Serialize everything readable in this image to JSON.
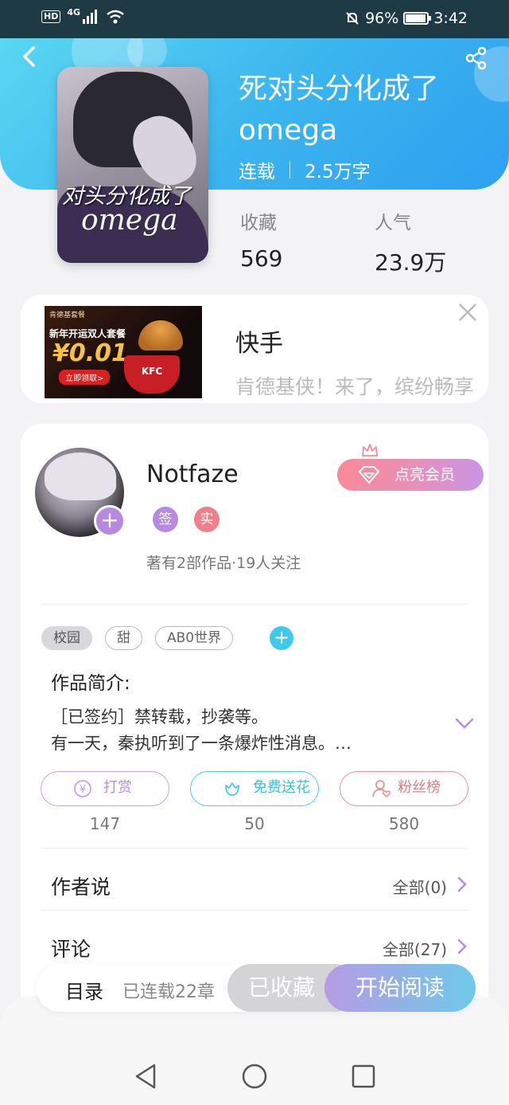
{
  "status_bar": {
    "network_badge": "HD",
    "network_type": "4G",
    "battery_percent": "96%",
    "battery_level": 0.96,
    "time": "3:42"
  },
  "book": {
    "title": "死对头分化成了omega",
    "status": "连载",
    "word_count": "2.5万字",
    "cover_title": "对头分化成了",
    "cover_subtitle": "omega",
    "stats": [
      {
        "label": "收藏",
        "value": "569"
      },
      {
        "label": "人气",
        "value": "23.9万"
      }
    ]
  },
  "ad": {
    "advertiser": "快手",
    "description": "肯德基侠！来了，缤纷畅享",
    "image_text": {
      "top": "肯德基套餐",
      "headline": "新年开运双人套餐",
      "price": "¥0.01",
      "cta": "立即领取>",
      "brand": "KFC"
    }
  },
  "author": {
    "name": "Notfaze",
    "badges": [
      {
        "label": "签",
        "color": "#b889e0"
      },
      {
        "label": "实",
        "color": "#f07f8a"
      }
    ],
    "stats": "著有2部作品·19人关注",
    "vip_button": "点亮会员"
  },
  "tags": [
    "校园",
    "甜",
    "AB0世界"
  ],
  "intro": {
    "label": "作品简介:",
    "line1": "［已签约］禁转载，抄袭等。",
    "line2": "有一天，秦执听到了一条爆炸性消息。…"
  },
  "actions": [
    {
      "label": "打赏",
      "count": "147",
      "color": "#c9a2e6"
    },
    {
      "label": "免费送花",
      "count": "50",
      "color": "#49cbe9"
    },
    {
      "label": "粉丝榜",
      "count": "580",
      "color": "#ee8f95"
    }
  ],
  "sections": [
    {
      "title": "作者说",
      "more": "全部(0)"
    },
    {
      "title": "评论",
      "more": "全部(27)"
    }
  ],
  "bottom_bar": {
    "toc": "目录",
    "chapters": "已连载22章",
    "collected": "已收藏",
    "read": "开始阅读"
  }
}
